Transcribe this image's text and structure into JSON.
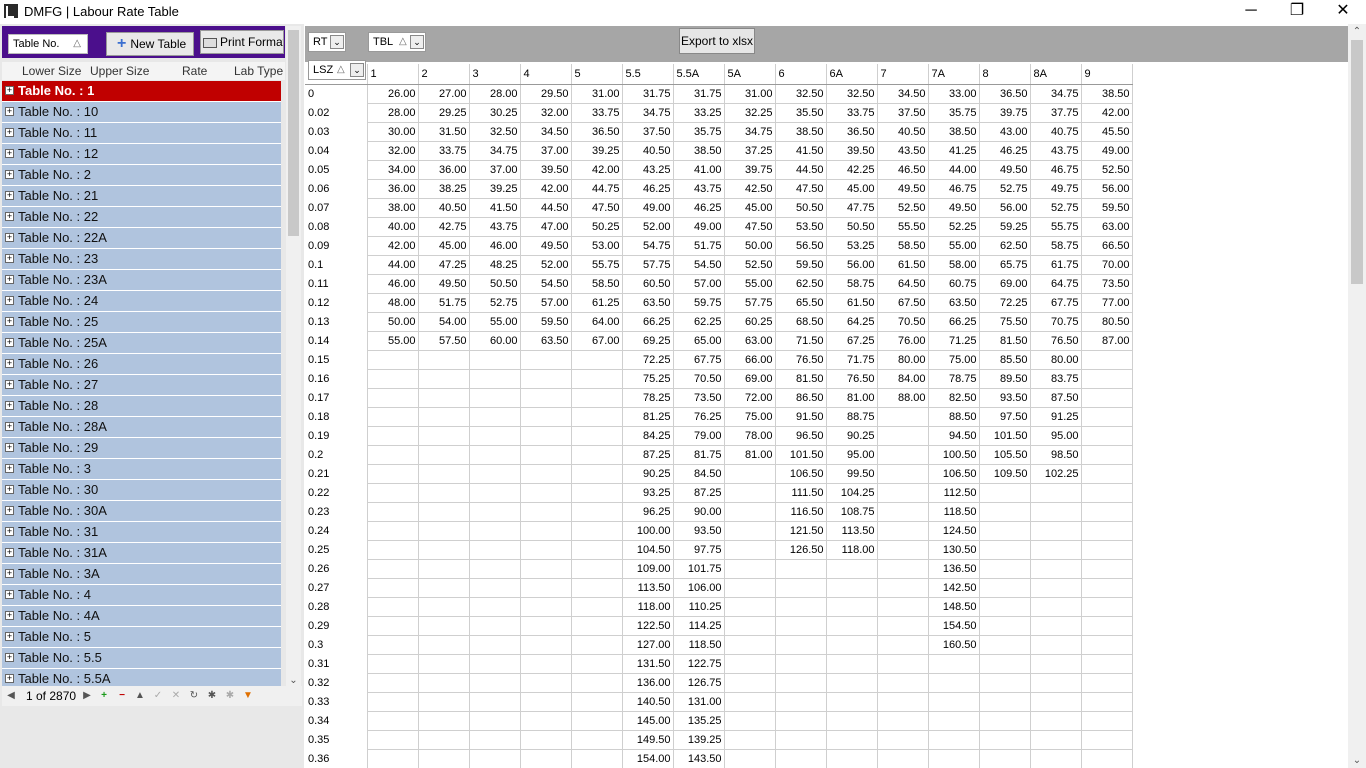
{
  "window": {
    "title": "DMFG | Labour Rate Table",
    "minimize": "─",
    "restore": "❐",
    "close": "✕"
  },
  "left": {
    "table_no_filter": "Table No.",
    "new_table_label": "New Table",
    "print_format_label": "Print Format",
    "headers": {
      "lower_size": "Lower Size",
      "upper_size": "Upper Size",
      "rate": "Rate",
      "lab_type": "Lab Type"
    },
    "tree_items": [
      "Table No. : 1",
      "Table No. : 10",
      "Table No. : 11",
      "Table No. : 12",
      "Table No. : 2",
      "Table No. : 21",
      "Table No. : 22",
      "Table No. : 22A",
      "Table No. : 23",
      "Table No. : 23A",
      "Table No. : 24",
      "Table No. : 25",
      "Table No. : 25A",
      "Table No. : 26",
      "Table No. : 27",
      "Table No. : 28",
      "Table No. : 28A",
      "Table No. : 29",
      "Table No. : 3",
      "Table No. : 30",
      "Table No. : 30A",
      "Table No. : 31",
      "Table No. : 31A",
      "Table No. : 3A",
      "Table No. : 4",
      "Table No. : 4A",
      "Table No. : 5",
      "Table No. : 5.5",
      "Table No. : 5.5A"
    ],
    "pager": "1 of 2870"
  },
  "right": {
    "rt_field": "RT",
    "tbl_field": "TBL",
    "lsz_field": "LSZ",
    "export_label": "Export to xlsx",
    "columns": [
      "1",
      "2",
      "3",
      "4",
      "5",
      "5.5",
      "5.5A",
      "5A",
      "6",
      "6A",
      "7",
      "7A",
      "8",
      "8A",
      "9"
    ],
    "rows": [
      {
        "lsz": "0",
        "v": [
          "26.00",
          "27.00",
          "28.00",
          "29.50",
          "31.00",
          "31.75",
          "31.75",
          "31.00",
          "32.50",
          "32.50",
          "34.50",
          "33.00",
          "36.50",
          "34.75",
          "38.50"
        ]
      },
      {
        "lsz": "0.02",
        "v": [
          "28.00",
          "29.25",
          "30.25",
          "32.00",
          "33.75",
          "34.75",
          "33.25",
          "32.25",
          "35.50",
          "33.75",
          "37.50",
          "35.75",
          "39.75",
          "37.75",
          "42.00"
        ]
      },
      {
        "lsz": "0.03",
        "v": [
          "30.00",
          "31.50",
          "32.50",
          "34.50",
          "36.50",
          "37.50",
          "35.75",
          "34.75",
          "38.50",
          "36.50",
          "40.50",
          "38.50",
          "43.00",
          "40.75",
          "45.50"
        ]
      },
      {
        "lsz": "0.04",
        "v": [
          "32.00",
          "33.75",
          "34.75",
          "37.00",
          "39.25",
          "40.50",
          "38.50",
          "37.25",
          "41.50",
          "39.50",
          "43.50",
          "41.25",
          "46.25",
          "43.75",
          "49.00"
        ]
      },
      {
        "lsz": "0.05",
        "v": [
          "34.00",
          "36.00",
          "37.00",
          "39.50",
          "42.00",
          "43.25",
          "41.00",
          "39.75",
          "44.50",
          "42.25",
          "46.50",
          "44.00",
          "49.50",
          "46.75",
          "52.50"
        ]
      },
      {
        "lsz": "0.06",
        "v": [
          "36.00",
          "38.25",
          "39.25",
          "42.00",
          "44.75",
          "46.25",
          "43.75",
          "42.50",
          "47.50",
          "45.00",
          "49.50",
          "46.75",
          "52.75",
          "49.75",
          "56.00"
        ]
      },
      {
        "lsz": "0.07",
        "v": [
          "38.00",
          "40.50",
          "41.50",
          "44.50",
          "47.50",
          "49.00",
          "46.25",
          "45.00",
          "50.50",
          "47.75",
          "52.50",
          "49.50",
          "56.00",
          "52.75",
          "59.50"
        ]
      },
      {
        "lsz": "0.08",
        "v": [
          "40.00",
          "42.75",
          "43.75",
          "47.00",
          "50.25",
          "52.00",
          "49.00",
          "47.50",
          "53.50",
          "50.50",
          "55.50",
          "52.25",
          "59.25",
          "55.75",
          "63.00"
        ]
      },
      {
        "lsz": "0.09",
        "v": [
          "42.00",
          "45.00",
          "46.00",
          "49.50",
          "53.00",
          "54.75",
          "51.75",
          "50.00",
          "56.50",
          "53.25",
          "58.50",
          "55.00",
          "62.50",
          "58.75",
          "66.50"
        ]
      },
      {
        "lsz": "0.1",
        "v": [
          "44.00",
          "47.25",
          "48.25",
          "52.00",
          "55.75",
          "57.75",
          "54.50",
          "52.50",
          "59.50",
          "56.00",
          "61.50",
          "58.00",
          "65.75",
          "61.75",
          "70.00"
        ]
      },
      {
        "lsz": "0.11",
        "v": [
          "46.00",
          "49.50",
          "50.50",
          "54.50",
          "58.50",
          "60.50",
          "57.00",
          "55.00",
          "62.50",
          "58.75",
          "64.50",
          "60.75",
          "69.00",
          "64.75",
          "73.50"
        ]
      },
      {
        "lsz": "0.12",
        "v": [
          "48.00",
          "51.75",
          "52.75",
          "57.00",
          "61.25",
          "63.50",
          "59.75",
          "57.75",
          "65.50",
          "61.50",
          "67.50",
          "63.50",
          "72.25",
          "67.75",
          "77.00"
        ]
      },
      {
        "lsz": "0.13",
        "v": [
          "50.00",
          "54.00",
          "55.00",
          "59.50",
          "64.00",
          "66.25",
          "62.25",
          "60.25",
          "68.50",
          "64.25",
          "70.50",
          "66.25",
          "75.50",
          "70.75",
          "80.50"
        ]
      },
      {
        "lsz": "0.14",
        "v": [
          "55.00",
          "57.50",
          "60.00",
          "63.50",
          "67.00",
          "69.25",
          "65.00",
          "63.00",
          "71.50",
          "67.25",
          "76.00",
          "71.25",
          "81.50",
          "76.50",
          "87.00"
        ]
      },
      {
        "lsz": "0.15",
        "v": [
          "",
          "",
          "",
          "",
          "",
          "72.25",
          "67.75",
          "66.00",
          "76.50",
          "71.75",
          "80.00",
          "75.00",
          "85.50",
          "80.00",
          ""
        ]
      },
      {
        "lsz": "0.16",
        "v": [
          "",
          "",
          "",
          "",
          "",
          "75.25",
          "70.50",
          "69.00",
          "81.50",
          "76.50",
          "84.00",
          "78.75",
          "89.50",
          "83.75",
          ""
        ]
      },
      {
        "lsz": "0.17",
        "v": [
          "",
          "",
          "",
          "",
          "",
          "78.25",
          "73.50",
          "72.00",
          "86.50",
          "81.00",
          "88.00",
          "82.50",
          "93.50",
          "87.50",
          ""
        ]
      },
      {
        "lsz": "0.18",
        "v": [
          "",
          "",
          "",
          "",
          "",
          "81.25",
          "76.25",
          "75.00",
          "91.50",
          "88.75",
          "",
          "88.50",
          "97.50",
          "91.25",
          ""
        ]
      },
      {
        "lsz": "0.19",
        "v": [
          "",
          "",
          "",
          "",
          "",
          "84.25",
          "79.00",
          "78.00",
          "96.50",
          "90.25",
          "",
          "94.50",
          "101.50",
          "95.00",
          ""
        ]
      },
      {
        "lsz": "0.2",
        "v": [
          "",
          "",
          "",
          "",
          "",
          "87.25",
          "81.75",
          "81.00",
          "101.50",
          "95.00",
          "",
          "100.50",
          "105.50",
          "98.50",
          ""
        ]
      },
      {
        "lsz": "0.21",
        "v": [
          "",
          "",
          "",
          "",
          "",
          "90.25",
          "84.50",
          "",
          "106.50",
          "99.50",
          "",
          "106.50",
          "109.50",
          "102.25",
          ""
        ]
      },
      {
        "lsz": "0.22",
        "v": [
          "",
          "",
          "",
          "",
          "",
          "93.25",
          "87.25",
          "",
          "111.50",
          "104.25",
          "",
          "112.50",
          "",
          "",
          ""
        ]
      },
      {
        "lsz": "0.23",
        "v": [
          "",
          "",
          "",
          "",
          "",
          "96.25",
          "90.00",
          "",
          "116.50",
          "108.75",
          "",
          "118.50",
          "",
          "",
          ""
        ]
      },
      {
        "lsz": "0.24",
        "v": [
          "",
          "",
          "",
          "",
          "",
          "100.00",
          "93.50",
          "",
          "121.50",
          "113.50",
          "",
          "124.50",
          "",
          "",
          ""
        ]
      },
      {
        "lsz": "0.25",
        "v": [
          "",
          "",
          "",
          "",
          "",
          "104.50",
          "97.75",
          "",
          "126.50",
          "118.00",
          "",
          "130.50",
          "",
          "",
          ""
        ]
      },
      {
        "lsz": "0.26",
        "v": [
          "",
          "",
          "",
          "",
          "",
          "109.00",
          "101.75",
          "",
          "",
          "",
          "",
          "136.50",
          "",
          "",
          ""
        ]
      },
      {
        "lsz": "0.27",
        "v": [
          "",
          "",
          "",
          "",
          "",
          "113.50",
          "106.00",
          "",
          "",
          "",
          "",
          "142.50",
          "",
          "",
          ""
        ]
      },
      {
        "lsz": "0.28",
        "v": [
          "",
          "",
          "",
          "",
          "",
          "118.00",
          "110.25",
          "",
          "",
          "",
          "",
          "148.50",
          "",
          "",
          ""
        ]
      },
      {
        "lsz": "0.29",
        "v": [
          "",
          "",
          "",
          "",
          "",
          "122.50",
          "114.25",
          "",
          "",
          "",
          "",
          "154.50",
          "",
          "",
          ""
        ]
      },
      {
        "lsz": "0.3",
        "v": [
          "",
          "",
          "",
          "",
          "",
          "127.00",
          "118.50",
          "",
          "",
          "",
          "",
          "160.50",
          "",
          "",
          ""
        ]
      },
      {
        "lsz": "0.31",
        "v": [
          "",
          "",
          "",
          "",
          "",
          "131.50",
          "122.75",
          "",
          "",
          "",
          "",
          "",
          "",
          "",
          ""
        ]
      },
      {
        "lsz": "0.32",
        "v": [
          "",
          "",
          "",
          "",
          "",
          "136.00",
          "126.75",
          "",
          "",
          "",
          "",
          "",
          "",
          "",
          ""
        ]
      },
      {
        "lsz": "0.33",
        "v": [
          "",
          "",
          "",
          "",
          "",
          "140.50",
          "131.00",
          "",
          "",
          "",
          "",
          "",
          "",
          "",
          ""
        ]
      },
      {
        "lsz": "0.34",
        "v": [
          "",
          "",
          "",
          "",
          "",
          "145.00",
          "135.25",
          "",
          "",
          "",
          "",
          "",
          "",
          "",
          ""
        ]
      },
      {
        "lsz": "0.35",
        "v": [
          "",
          "",
          "",
          "",
          "",
          "149.50",
          "139.25",
          "",
          "",
          "",
          "",
          "",
          "",
          "",
          ""
        ]
      },
      {
        "lsz": "0.36",
        "v": [
          "",
          "",
          "",
          "",
          "",
          "154.00",
          "143.50",
          "",
          "",
          "",
          "",
          "",
          "",
          "",
          ""
        ]
      }
    ]
  }
}
